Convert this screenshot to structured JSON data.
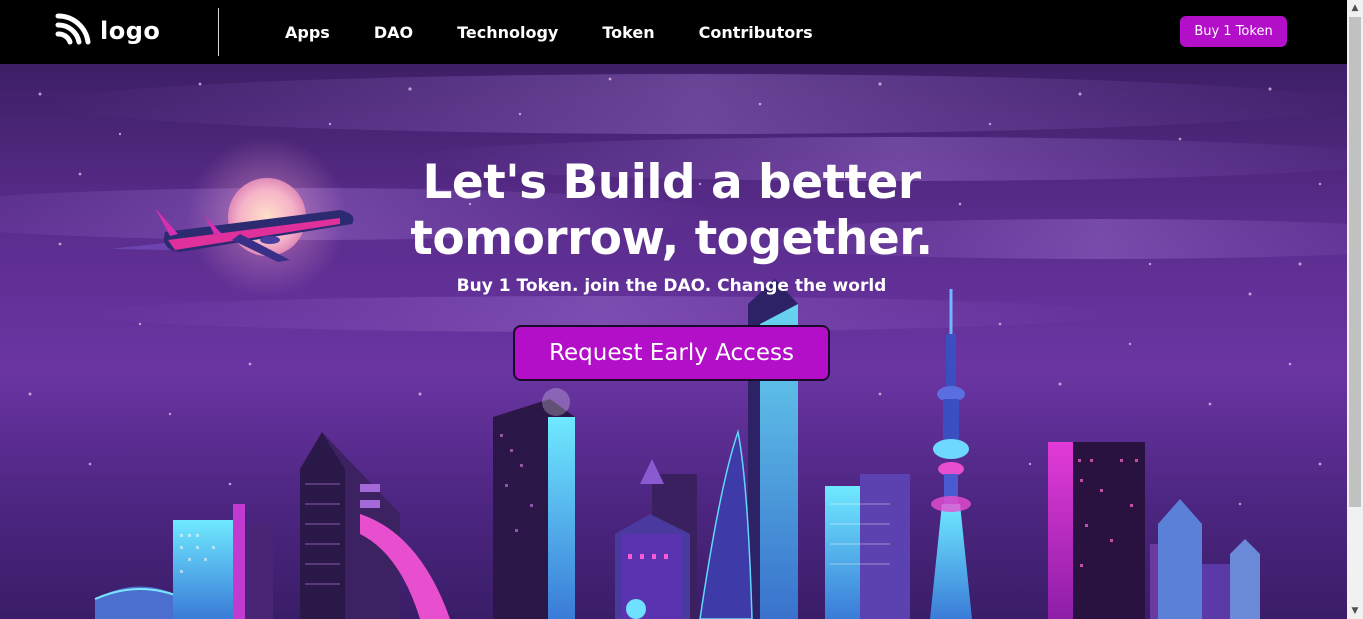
{
  "header": {
    "logo_text": "logo",
    "nav": [
      {
        "label": "Apps"
      },
      {
        "label": "DAO"
      },
      {
        "label": "Technology"
      },
      {
        "label": "Token"
      },
      {
        "label": "Contributors"
      }
    ],
    "buy_label": "Buy 1 Token"
  },
  "hero": {
    "title_line1": "Let's Build a better",
    "title_line2": "tomorrow, together.",
    "subtitle": "Buy 1 Token. join the DAO. Change the world",
    "cta_label": "Request Early Access"
  },
  "colors": {
    "accent": "#b30fc8",
    "navbar_bg": "#000000",
    "hero_purple": "#5b2d8e",
    "neon_cyan": "#3fd8f0",
    "neon_pink": "#e23ad6"
  },
  "icons": {
    "logo": "wifi-arcs-icon",
    "scroll_up": "arrow-up-icon",
    "scroll_down": "arrow-down-icon"
  }
}
